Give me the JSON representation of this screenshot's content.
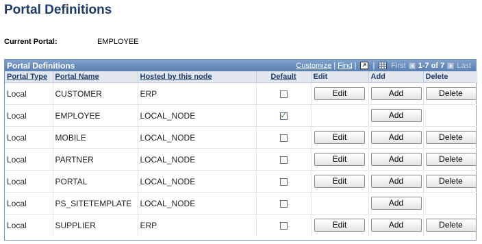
{
  "page": {
    "title": "Portal Definitions"
  },
  "current_portal": {
    "label": "Current Portal:",
    "value": "EMPLOYEE"
  },
  "grid": {
    "title": "Portal Definitions",
    "tools": {
      "customize": "Customize",
      "separator": "|",
      "find": "Find",
      "first": "First",
      "range": "1-7 of 7",
      "last": "Last",
      "view_all_icon": "view-all-icon",
      "download_icon": "spreadsheet-icon"
    },
    "columns": {
      "portal_type": "Portal Type",
      "portal_name": "Portal Name",
      "hosted": "Hosted by this node",
      "default": "Default",
      "edit": "Edit",
      "add": "Add",
      "delete": "Delete"
    },
    "rows": [
      {
        "type": "Local",
        "name": "CUSTOMER",
        "host": "ERP",
        "default": false,
        "edit": "Edit",
        "add": "Add",
        "delete": "Delete"
      },
      {
        "type": "Local",
        "name": "EMPLOYEE",
        "host": "LOCAL_NODE",
        "default": true,
        "edit": "",
        "add": "Add",
        "delete": ""
      },
      {
        "type": "Local",
        "name": "MOBILE",
        "host": "LOCAL_NODE",
        "default": false,
        "edit": "Edit",
        "add": "Add",
        "delete": "Delete"
      },
      {
        "type": "Local",
        "name": "PARTNER",
        "host": "LOCAL_NODE",
        "default": false,
        "edit": "Edit",
        "add": "Add",
        "delete": "Delete"
      },
      {
        "type": "Local",
        "name": "PORTAL",
        "host": "LOCAL_NODE",
        "default": false,
        "edit": "Edit",
        "add": "Add",
        "delete": "Delete"
      },
      {
        "type": "Local",
        "name": "PS_SITETEMPLATE",
        "host": "LOCAL_NODE",
        "default": false,
        "edit": "",
        "add": "Add",
        "delete": ""
      },
      {
        "type": "Local",
        "name": "SUPPLIER",
        "host": "ERP",
        "default": false,
        "edit": "Edit",
        "add": "Add",
        "delete": "Delete"
      }
    ]
  },
  "colors": {
    "title": "#1d3b64",
    "grid_header": "#6a8dbc",
    "column_header_bg": "#e3e8f0"
  }
}
